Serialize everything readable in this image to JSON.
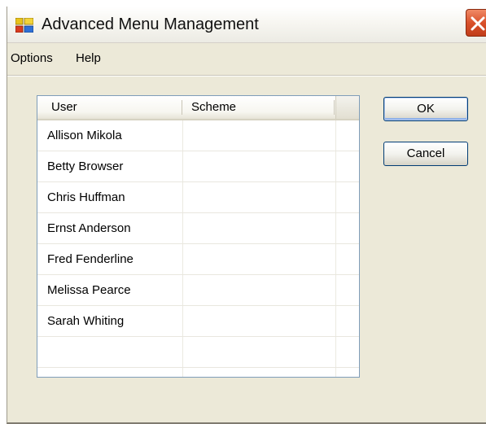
{
  "window": {
    "title": "Advanced Menu Management",
    "icon": "app-window-icon",
    "close_icon": "close-icon",
    "colors": {
      "title_bar": "#f7f6f1",
      "window_bg": "#ece9d8",
      "close_button": "#d9512b",
      "button_border": "#003c74"
    }
  },
  "menu": {
    "items": [
      {
        "label": "Options"
      },
      {
        "label": "Help"
      }
    ]
  },
  "list": {
    "columns": [
      {
        "label": "User"
      },
      {
        "label": "Scheme"
      }
    ],
    "rows": [
      {
        "user": "Allison Mikola",
        "scheme": ""
      },
      {
        "user": "Betty Browser",
        "scheme": ""
      },
      {
        "user": "Chris Huffman",
        "scheme": ""
      },
      {
        "user": "Ernst Anderson",
        "scheme": ""
      },
      {
        "user": "Fred Fenderline",
        "scheme": ""
      },
      {
        "user": "Melissa Pearce",
        "scheme": ""
      },
      {
        "user": "Sarah Whiting",
        "scheme": ""
      },
      {
        "user": "",
        "scheme": ""
      },
      {
        "user": "",
        "scheme": ""
      }
    ]
  },
  "buttons": {
    "ok_label": "OK",
    "cancel_label": "Cancel"
  }
}
